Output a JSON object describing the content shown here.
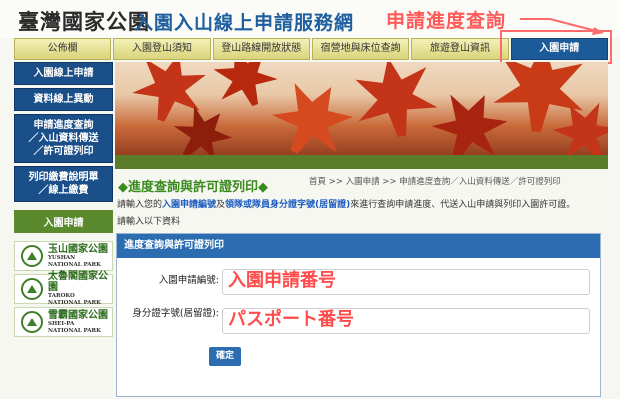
{
  "header": {
    "logo": "臺灣國家公園",
    "site_title": "入園入山線上申請服務網",
    "annotation": "申請進度查詢"
  },
  "nav": {
    "items": [
      "公佈欄",
      "入園登山須知",
      "登山路線開放狀態",
      "宿營地與床位查詢",
      "旅遊登山資訊",
      "入園申請"
    ],
    "active_index": 5
  },
  "sidebar": {
    "buttons": [
      "入園線上申請",
      "資料線上異動",
      "申請進度查詢\n／入山資料傳送\n／許可證列印",
      "列印繳費說明單\n／線上繳費"
    ],
    "section_title": "入園申請",
    "parks": [
      {
        "zh": "玉山國家公園",
        "en1": "YUSHAN",
        "en2": "NATIONAL PARK"
      },
      {
        "zh": "太魯閣國家公園",
        "en1": "TAROKO",
        "en2": "NATIONAL PARK"
      },
      {
        "zh": "雪霸國家公園",
        "en1": "SHEI-PA",
        "en2": "NATIONAL PARK"
      }
    ]
  },
  "content": {
    "section_title": "◆進度查詢與許可證列印◆",
    "breadcrumb": "首頁 >> 入園申請 >> 申請進度查詢／入山資料傳送／許可證列印",
    "intro": {
      "pre": "請輸入您的",
      "hl1": "入園申請編號",
      "mid": "及",
      "hl2": "領隊或隊員身分證字號(居留證)",
      "post": "來進行查詢申請進度、代送入山申請與列印入園許可證。"
    },
    "intro2": "請輸入以下資料"
  },
  "form": {
    "panel_title": "進度查詢與許可證列印",
    "field1_label": "入園申請編號:",
    "field1_value": "入園申請番号",
    "field2_label": "身分證字號(居留證):",
    "field2_value": "パスポート番号",
    "submit_label": "確定"
  },
  "colors": {
    "accent_blue": "#2b6db0",
    "annotation_red": "#ff5a5a",
    "title_green": "#3a8a1e"
  }
}
